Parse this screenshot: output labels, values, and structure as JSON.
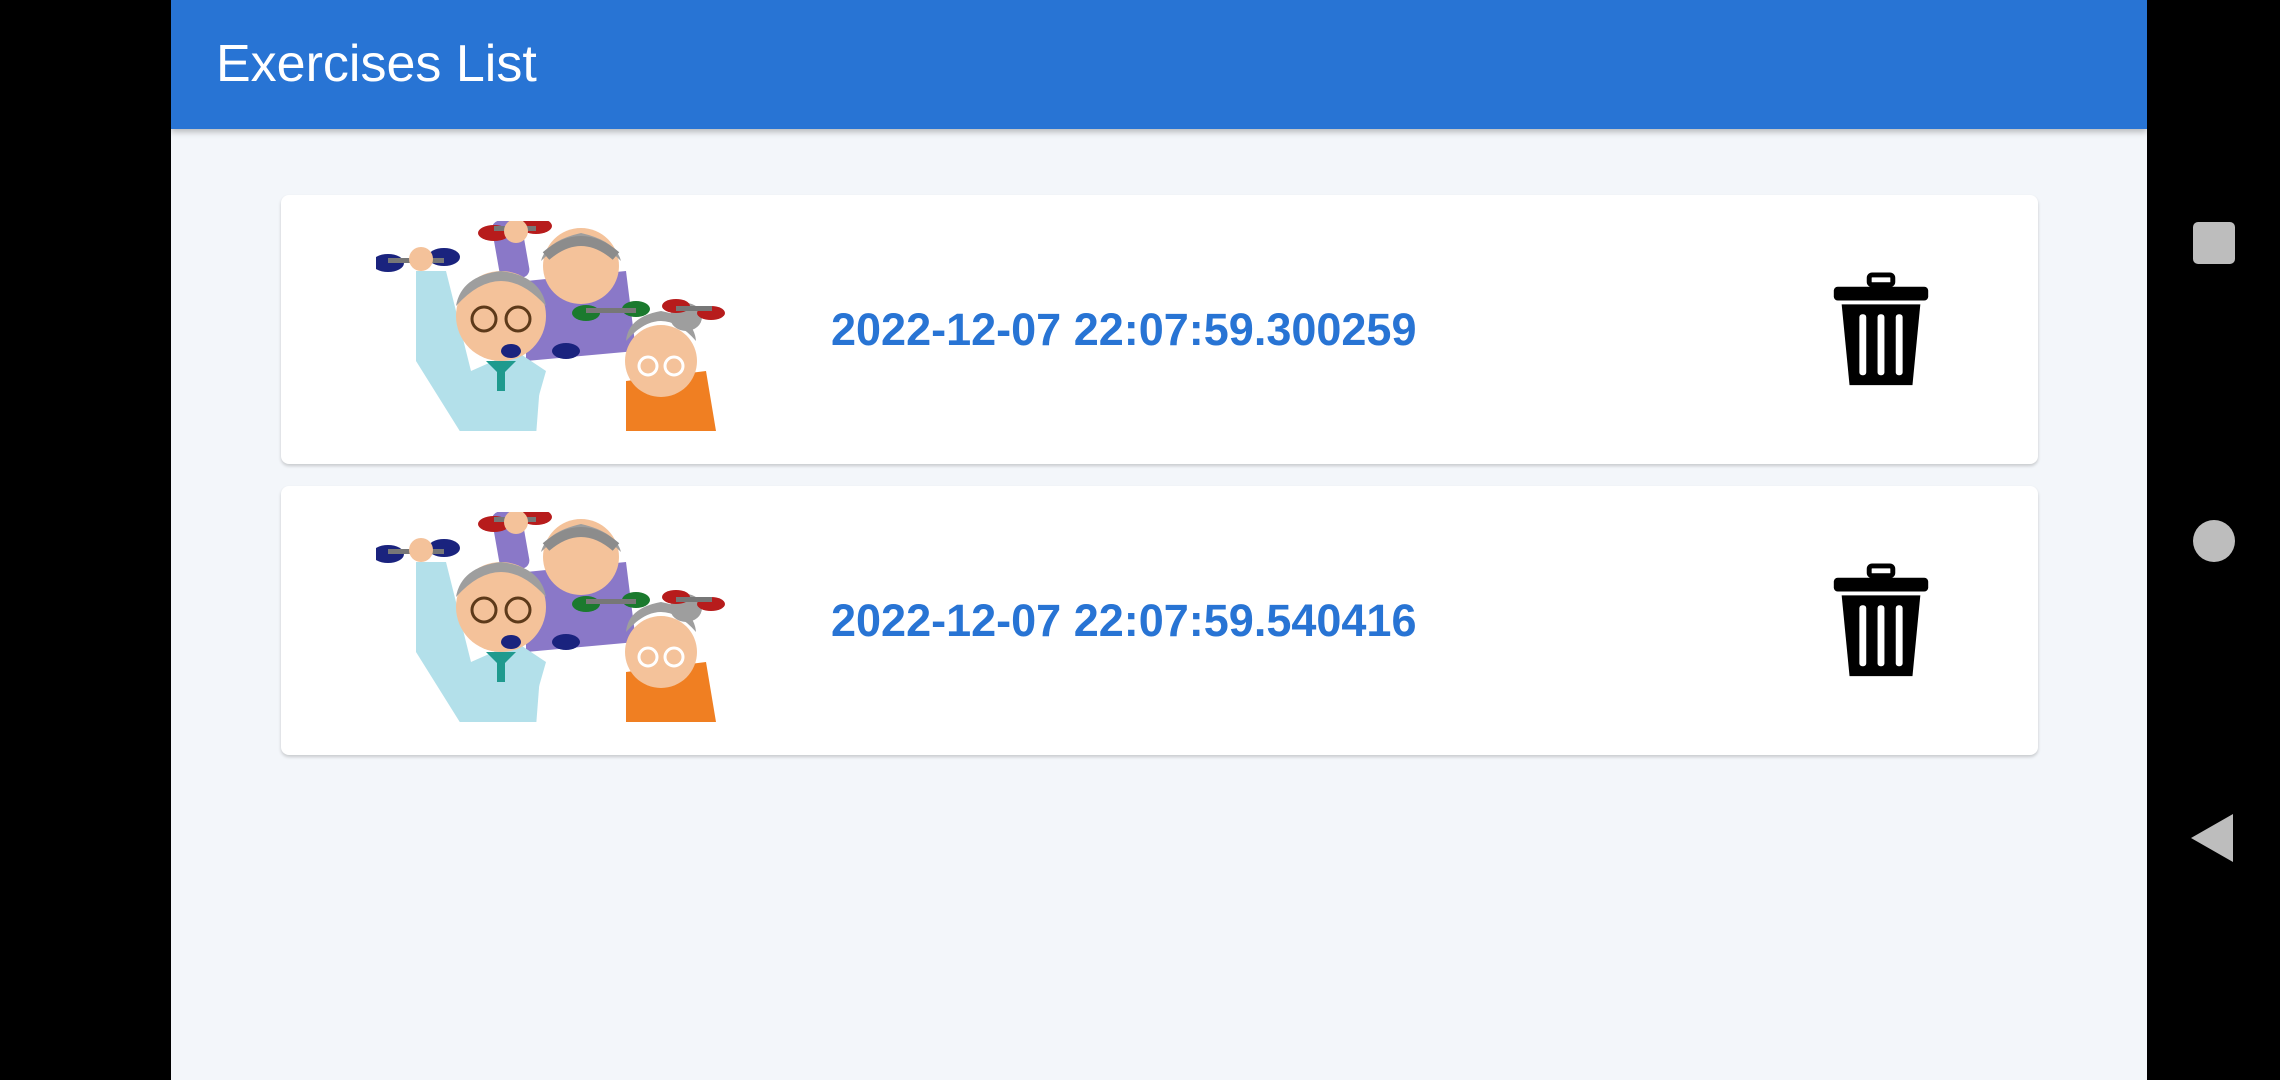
{
  "appbar": {
    "title": "Exercises List",
    "color": "#2874d4"
  },
  "exercises": [
    {
      "timestamp": "2022-12-07 22:07:59.300259",
      "image": "elderly-exercise-illustration",
      "delete_icon": "trash-icon"
    },
    {
      "timestamp": "2022-12-07 22:07:59.540416",
      "image": "elderly-exercise-illustration",
      "delete_icon": "trash-icon"
    }
  ],
  "system_nav": {
    "buttons": [
      "recents-icon",
      "home-icon",
      "back-icon"
    ]
  },
  "colors": {
    "accent": "#2874d4",
    "background": "#f3f6fa",
    "card": "#ffffff"
  }
}
